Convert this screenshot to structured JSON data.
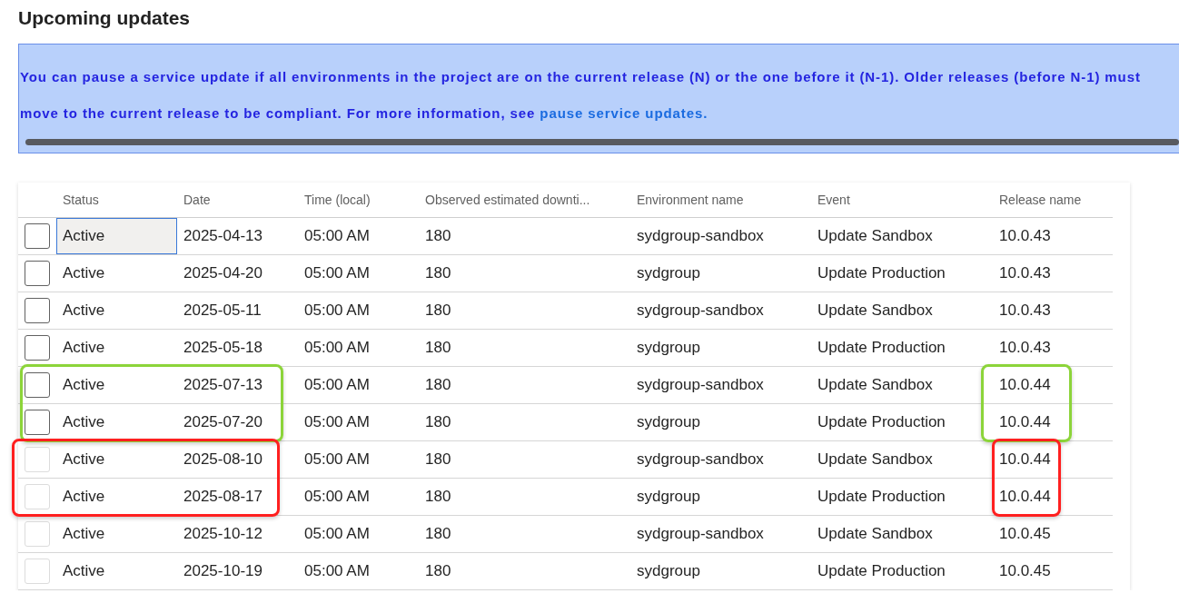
{
  "title": "Upcoming updates",
  "banner": {
    "text": "You can pause a service update if all environments in the project are on the current release (N) or the one before it (N-1). Older releases (before N-1) must move to the current release to be compliant. For more information, see ",
    "link": "pause service updates."
  },
  "table": {
    "columns": [
      "Status",
      "Date",
      "Time (local)",
      "Observed estimated downti...",
      "Environment name",
      "Event",
      "Release name"
    ],
    "rows": [
      {
        "checked": false,
        "disabled": false,
        "focused": true,
        "cells": [
          "Active",
          "2025-04-13",
          "05:00 AM",
          "180",
          "sydgroup-sandbox",
          "Update Sandbox",
          "10.0.43"
        ]
      },
      {
        "checked": false,
        "disabled": false,
        "focused": false,
        "cells": [
          "Active",
          "2025-04-20",
          "05:00 AM",
          "180",
          "sydgroup",
          "Update Production",
          "10.0.43"
        ]
      },
      {
        "checked": false,
        "disabled": false,
        "focused": false,
        "cells": [
          "Active",
          "2025-05-11",
          "05:00 AM",
          "180",
          "sydgroup-sandbox",
          "Update Sandbox",
          "10.0.43"
        ]
      },
      {
        "checked": false,
        "disabled": false,
        "focused": false,
        "cells": [
          "Active",
          "2025-05-18",
          "05:00 AM",
          "180",
          "sydgroup",
          "Update Production",
          "10.0.43"
        ]
      },
      {
        "checked": false,
        "disabled": false,
        "focused": false,
        "color": "#8cd43a",
        "cells": [
          "Active",
          "2025-07-13",
          "05:00 AM",
          "180",
          "sydgroup-sandbox",
          "Update Sandbox",
          "10.0.44"
        ]
      },
      {
        "checked": false,
        "disabled": false,
        "focused": false,
        "color": "#8cd43a",
        "cells": [
          "Active",
          "2025-07-20",
          "05:00 AM",
          "180",
          "sydgroup",
          "Update Production",
          "10.0.44"
        ]
      },
      {
        "checked": false,
        "disabled": true,
        "focused": false,
        "color": "#ff2020",
        "cells": [
          "Active",
          "2025-08-10",
          "05:00 AM",
          "180",
          "sydgroup-sandbox",
          "Update Sandbox",
          "10.0.44"
        ]
      },
      {
        "checked": false,
        "disabled": true,
        "focused": false,
        "color": "#ff2020",
        "cells": [
          "Active",
          "2025-08-17",
          "05:00 AM",
          "180",
          "sydgroup",
          "Update Production",
          "10.0.44"
        ]
      },
      {
        "checked": false,
        "disabled": true,
        "focused": false,
        "cells": [
          "Active",
          "2025-10-12",
          "05:00 AM",
          "180",
          "sydgroup-sandbox",
          "Update Sandbox",
          "10.0.45"
        ]
      },
      {
        "checked": false,
        "disabled": true,
        "focused": false,
        "cells": [
          "Active",
          "2025-10-19",
          "05:00 AM",
          "180",
          "sydgroup",
          "Update Production",
          "10.0.45"
        ]
      }
    ]
  }
}
